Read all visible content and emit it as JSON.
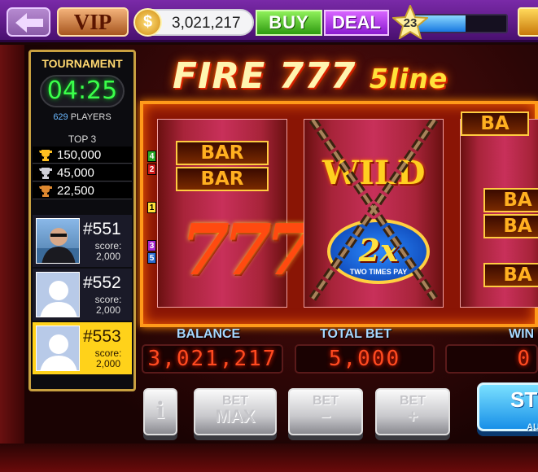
{
  "topbar": {
    "vip_label": "VIP",
    "coin_symbol": "$",
    "coins": "3,021,217",
    "buy_label": "BUY",
    "deal_label": "DEAL",
    "level": "23",
    "xp_progress": 0.55
  },
  "tournament": {
    "title": "TOURNAMENT",
    "timer": "04:25",
    "players_count": "629",
    "players_label": "PLAYERS",
    "top3_label": "TOP 3",
    "top3": [
      "150,000",
      "45,000",
      "22,500"
    ],
    "leaderboard": [
      {
        "rank": "#551",
        "score_label": "score:",
        "score": "2,000"
      },
      {
        "rank": "#552",
        "score_label": "score:",
        "score": "2,000"
      },
      {
        "rank": "#553",
        "score_label": "score:",
        "score": "2,000"
      }
    ]
  },
  "machine": {
    "title": "FIRE 777",
    "title_suffix": "5line",
    "reel1": {
      "bar1": "BAR",
      "bar2": "BAR",
      "seven": "7"
    },
    "reel2": {
      "wild": "WILD",
      "multiplier": "2x",
      "multiplier_text": "TWO TIMES PAY"
    },
    "reel3": {
      "top": "BA",
      "mid1": "BA",
      "mid2": "BA",
      "bottom": "BA"
    },
    "paylines": [
      "4",
      "2",
      "1",
      "3",
      "5"
    ],
    "payline_colors": [
      "#2aa82a",
      "#d01a1a",
      "#ffe03a",
      "#a82ad0",
      "#2a6ad0"
    ]
  },
  "stats": {
    "balance_label": "BALANCE",
    "balance": "3,021,217",
    "total_bet_label": "TOTAL BET",
    "total_bet": "5,000",
    "win_label": "WIN",
    "win": "0"
  },
  "buttons": {
    "info": "i",
    "bet_max_top": "BET",
    "bet_max_bottom": "MAX",
    "bet_minus_top": "BET",
    "bet_minus_bottom": "−",
    "bet_plus_top": "BET",
    "bet_plus_bottom": "+",
    "spin": "ST",
    "auto": "AU"
  }
}
